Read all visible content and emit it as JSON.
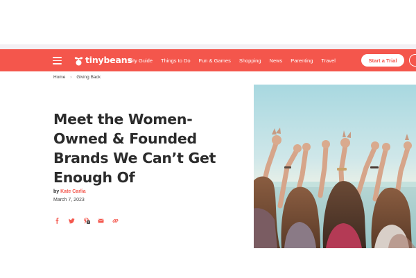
{
  "header": {
    "logo_text": "tinybeans",
    "nav_links": [
      "City Guide",
      "Things to Do",
      "Fun & Games",
      "Shopping",
      "News",
      "Parenting",
      "Travel"
    ],
    "cta_label": "Start a Trial"
  },
  "breadcrumb": {
    "home": "Home",
    "separator": "›",
    "current": "Giving Back"
  },
  "article": {
    "title": "Meet the Women-Owned & Founded Brands We Can’t Get Enough Of",
    "byline_prefix": "by",
    "author": "Kate Carlia",
    "date": "March 7, 2023",
    "pinterest_count": "2"
  },
  "share_icons": [
    "facebook-icon",
    "twitter-icon",
    "pinterest-icon",
    "email-icon",
    "link-icon"
  ],
  "colors": {
    "brand": "#f4564c",
    "text": "#2b2b2b",
    "white": "#ffffff"
  }
}
